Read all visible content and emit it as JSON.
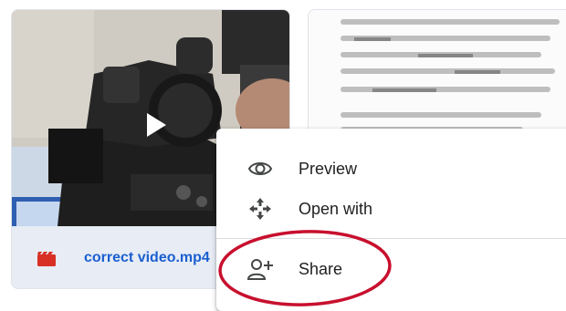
{
  "video_card": {
    "file_name": "correct video.mp4",
    "file_type_icon": "video-file-icon",
    "thumbnail_icon": "play-icon"
  },
  "context_menu": {
    "items": [
      {
        "label": "Preview",
        "icon": "eye-icon"
      },
      {
        "label": "Open with",
        "icon": "move-arrows-icon"
      },
      {
        "label": "Share",
        "icon": "person-add-icon"
      }
    ]
  },
  "colors": {
    "file_name": "#1a5fd0",
    "file_icon": "#d93025",
    "annotation": "#c8102e",
    "menu_text": "#1f1f1f"
  }
}
